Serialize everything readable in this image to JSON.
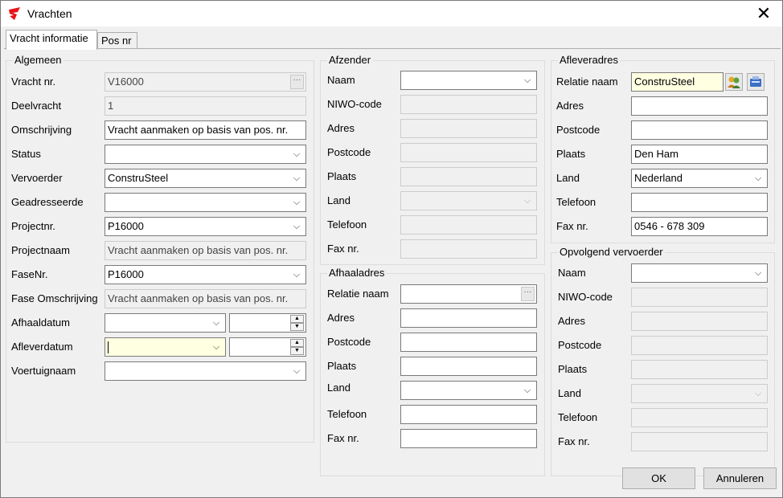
{
  "window": {
    "title": "Vrachten"
  },
  "tabs": [
    {
      "label": "Vracht informatie"
    },
    {
      "label": "Pos nr"
    }
  ],
  "algemeen": {
    "title": "Algemeen",
    "vracht_nr": {
      "label": "Vracht nr.",
      "value": "V16000"
    },
    "deelvracht": {
      "label": "Deelvracht",
      "value": "1"
    },
    "omschrijving": {
      "label": "Omschrijving",
      "value": "Vracht aanmaken op basis van pos. nr."
    },
    "status": {
      "label": "Status",
      "value": ""
    },
    "vervoerder": {
      "label": "Vervoerder",
      "value": "ConstruSteel"
    },
    "geadresseerde": {
      "label": "Geadresseerde",
      "value": ""
    },
    "projectnr": {
      "label": "Projectnr.",
      "value": "P16000"
    },
    "projectnaam": {
      "label": "Projectnaam",
      "value": "Vracht aanmaken op basis van pos. nr."
    },
    "fasenr": {
      "label": "FaseNr.",
      "value": "P16000"
    },
    "fase_omschrijving": {
      "label": "Fase Omschrijving",
      "value": "Vracht aanmaken op basis van pos. nr."
    },
    "afhaaldatum": {
      "label": "Afhaaldatum",
      "value": ""
    },
    "afleverdatum": {
      "label": "Afleverdatum",
      "value": ""
    },
    "voertuignaam": {
      "label": "Voertuignaam",
      "value": ""
    }
  },
  "afzender": {
    "title": "Afzender",
    "naam": {
      "label": "Naam",
      "value": ""
    },
    "niwo": {
      "label": "NIWO-code",
      "value": ""
    },
    "adres": {
      "label": "Adres",
      "value": ""
    },
    "postcode": {
      "label": "Postcode",
      "value": ""
    },
    "plaats": {
      "label": "Plaats",
      "value": ""
    },
    "land": {
      "label": "Land",
      "value": ""
    },
    "telefoon": {
      "label": "Telefoon",
      "value": ""
    },
    "fax": {
      "label": "Fax nr.",
      "value": ""
    }
  },
  "afhaaladres": {
    "title": "Afhaaladres",
    "relatie": {
      "label": "Relatie naam",
      "value": ""
    },
    "adres": {
      "label": "Adres",
      "value": ""
    },
    "postcode": {
      "label": "Postcode",
      "value": ""
    },
    "plaats": {
      "label": "Plaats",
      "value": ""
    },
    "land": {
      "label": "Land",
      "value": ""
    },
    "telefoon": {
      "label": "Telefoon",
      "value": ""
    },
    "fax": {
      "label": "Fax nr.",
      "value": ""
    }
  },
  "afleveradres": {
    "title": "Afleveradres",
    "relatie": {
      "label": "Relatie naam",
      "value": "ConstruSteel"
    },
    "adres": {
      "label": "Adres",
      "value": ""
    },
    "postcode": {
      "label": "Postcode",
      "value": ""
    },
    "plaats": {
      "label": "Plaats",
      "value": "Den Ham"
    },
    "land": {
      "label": "Land",
      "value": "Nederland"
    },
    "telefoon": {
      "label": "Telefoon",
      "value": ""
    },
    "fax": {
      "label": "Fax nr.",
      "value": "0546 - 678 309"
    }
  },
  "opvolgend": {
    "title": "Opvolgend vervoerder",
    "naam": {
      "label": "Naam",
      "value": ""
    },
    "niwo": {
      "label": "NIWO-code",
      "value": ""
    },
    "adres": {
      "label": "Adres",
      "value": ""
    },
    "postcode": {
      "label": "Postcode",
      "value": ""
    },
    "plaats": {
      "label": "Plaats",
      "value": ""
    },
    "land": {
      "label": "Land",
      "value": ""
    },
    "telefoon": {
      "label": "Telefoon",
      "value": ""
    },
    "fax": {
      "label": "Fax nr.",
      "value": ""
    }
  },
  "buttons": {
    "ok": "OK",
    "cancel": "Annuleren"
  },
  "glyphs": {
    "close": "✕",
    "chevron": "⌵",
    "dots": "···",
    "up": "▲",
    "down": "▼"
  }
}
